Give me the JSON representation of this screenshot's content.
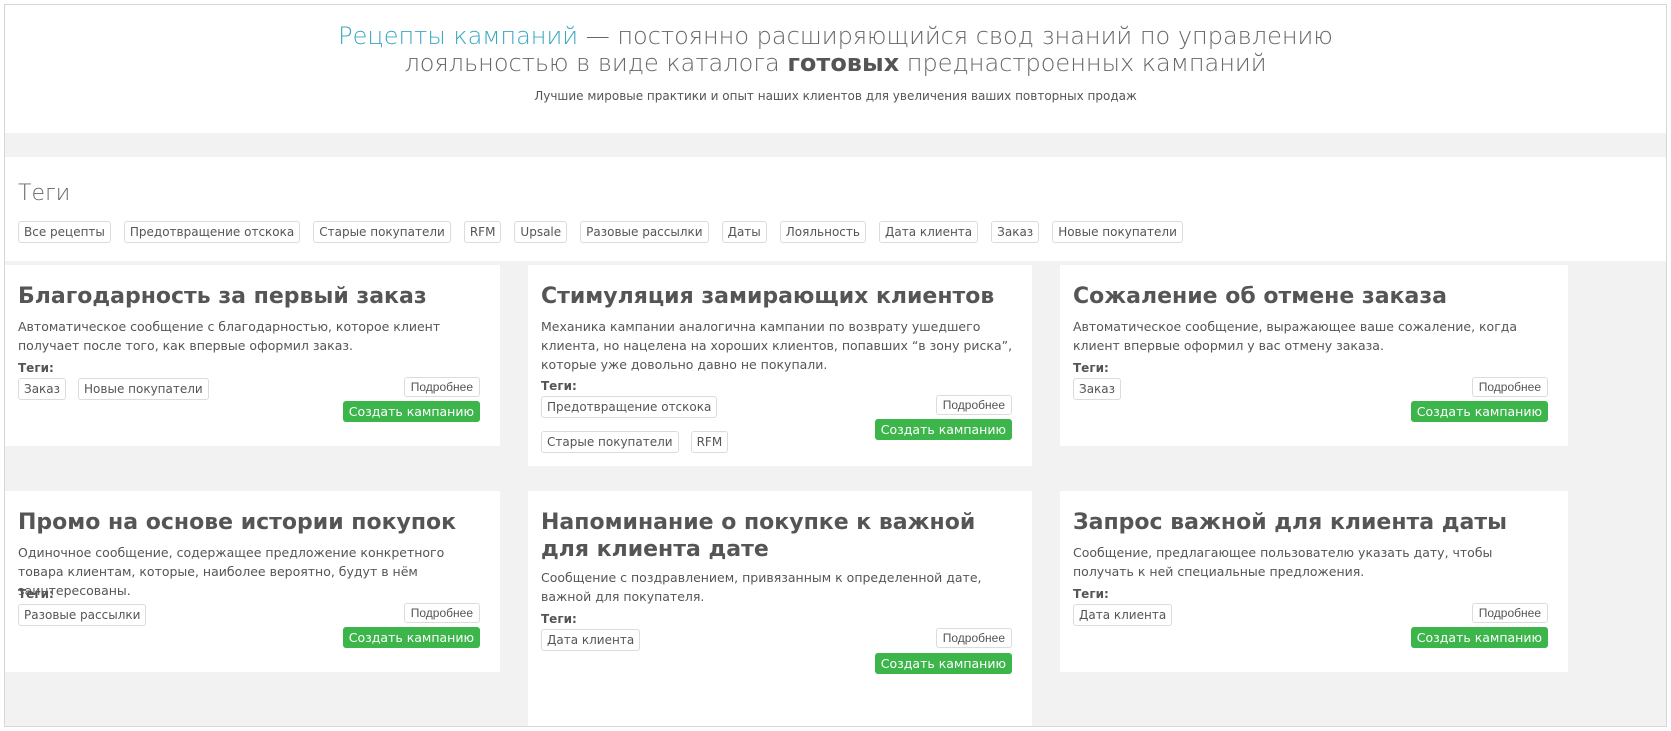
{
  "hero": {
    "title_accent": "Рецепты кампаний",
    "title_rest1": " — постоянно расширяющийся свод знаний по управлению",
    "title_line2_a": "лояльностью в виде каталога ",
    "title_line2_bold": "готовых",
    "title_line2_b": " преднастроенных кампаний",
    "subtitle": "Лучшие мировые практики и опыт наших клиентов для увеличения ваших повторных продаж"
  },
  "tags": {
    "heading": "Теги",
    "items": [
      "Все рецепты",
      "Предотвращение отскока",
      "Старые покупатели",
      "RFM",
      "Upsale",
      "Разовые рассылки",
      "Даты",
      "Лояльность",
      "Дата клиента",
      "Заказ",
      "Новые покупатели"
    ]
  },
  "labels": {
    "tags_label": "Теги:",
    "more": "Подробнее",
    "create": "Создать кампанию"
  },
  "cards": [
    {
      "title": "Благодарность за первый заказ",
      "description": "Автоматическое сообщение с благодарностью, которое клиент получает после того, как впервые оформил заказ.",
      "tags": [
        "Заказ",
        "Новые покупатели"
      ]
    },
    {
      "title": "Стимуляция замирающих клиентов",
      "description": "Механика кампании аналогична кампании по возврату ушедшего клиента, но нацелена на хороших клиентов, попавших “в зону риска”, которые уже довольно давно не покупали.",
      "tags": [
        "Предотвращение отскока",
        "Старые покупатели",
        "RFM"
      ]
    },
    {
      "title": "Сожаление об отмене заказа",
      "description": "Автоматическое сообщение, выражающее ваше сожаление, когда клиент впервые оформил у вас отмену заказа.",
      "tags": [
        "Заказ"
      ]
    },
    {
      "title": "Промо на основе истории покупок",
      "description": "Одиночное сообщение, содержащее предложение конкретного товара клиентам, которые, наиболее вероятно, будут в нём заинтересованы.",
      "tags": [
        "Разовые рассылки"
      ]
    },
    {
      "title": "Напоминание о покупке к важной для клиента дате",
      "description": "Сообщение с поздравлением, привязанным к определенной дате, важной для покупателя.",
      "tags": [
        "Дата клиента"
      ]
    },
    {
      "title": "Запрос важной для клиента даты",
      "description": "Сообщение, предлагающее пользователю указать дату, чтобы получать к ней специальные предложения.",
      "tags": [
        "Дата клиента"
      ]
    }
  ]
}
